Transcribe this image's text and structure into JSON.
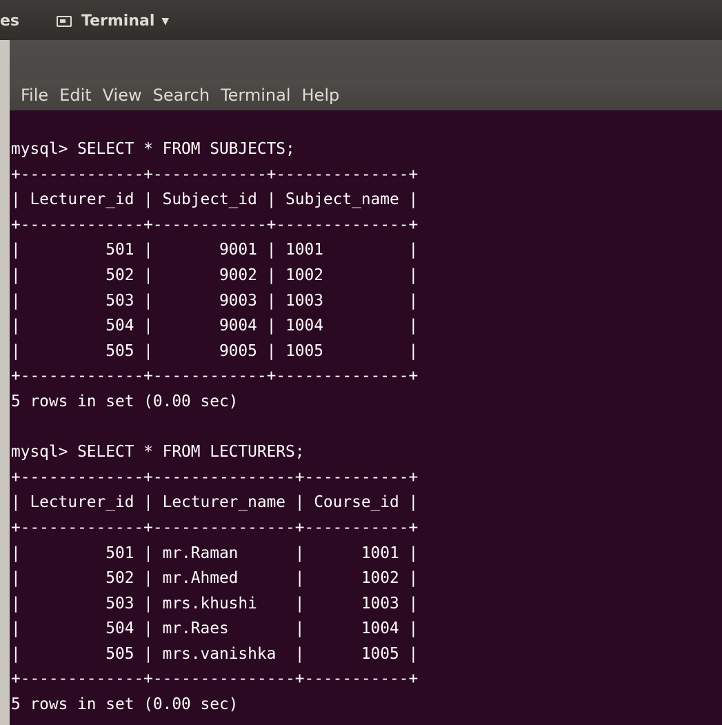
{
  "top_panel": {
    "crumb": "es",
    "app_menu_label": "Terminal",
    "app_menu_caret": "▼",
    "icon": "terminal-icon"
  },
  "menubar": {
    "items": [
      "File",
      "Edit",
      "View",
      "Search",
      "Terminal",
      "Help"
    ]
  },
  "terminal": {
    "lines": [
      "mysql> SELECT * FROM SUBJECTS;",
      "+-------------+------------+--------------+",
      "| Lecturer_id | Subject_id | Subject_name |",
      "+-------------+------------+--------------+",
      "|         501 |       9001 | 1001         |",
      "|         502 |       9002 | 1002         |",
      "|         503 |       9003 | 1003         |",
      "|         504 |       9004 | 1004         |",
      "|         505 |       9005 | 1005         |",
      "+-------------+------------+--------------+",
      "5 rows in set (0.00 sec)",
      "",
      "mysql> SELECT * FROM LECTURERS;",
      "+-------------+---------------+-----------+",
      "| Lecturer_id | Lecturer_name | Course_id |",
      "+-------------+---------------+-----------+",
      "|         501 | mr.Raman      |      1001 |",
      "|         502 | mr.Ahmed      |      1002 |",
      "|         503 | mrs.khushi    |      1003 |",
      "|         504 | mr.Raes       |      1004 |",
      "|         505 | mrs.vanishka  |      1005 |",
      "+-------------+---------------+-----------+",
      "5 rows in set (0.00 sec)"
    ]
  },
  "colors": {
    "terminal_bg": "#2c0922",
    "terminal_fg": "#ffffff",
    "panel_bg": "#3c3b37",
    "menubar_bg": "#4c4b47",
    "menubar_fg": "#dfdbd2"
  }
}
